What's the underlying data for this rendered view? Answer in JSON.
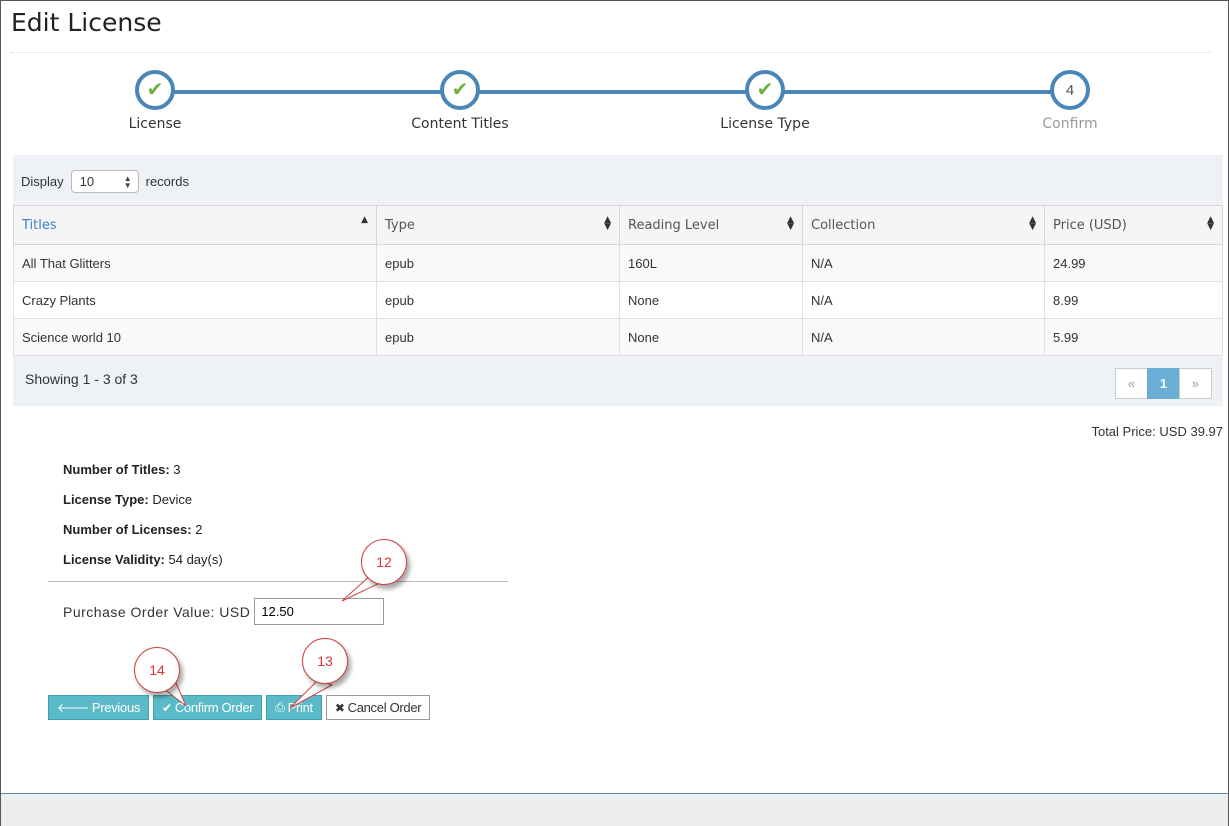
{
  "page": {
    "title": "Edit License"
  },
  "wizard": {
    "steps": [
      {
        "label": "License",
        "state": "done",
        "marker": "✔"
      },
      {
        "label": "Content Titles",
        "state": "done",
        "marker": "✔"
      },
      {
        "label": "License Type",
        "state": "done",
        "marker": "✔"
      },
      {
        "label": "Confirm",
        "state": "pending",
        "marker": "4"
      }
    ]
  },
  "records": {
    "prefix": "Display",
    "value": "10",
    "suffix": "records"
  },
  "table": {
    "columns": [
      "Titles",
      "Type",
      "Reading Level",
      "Collection",
      "Price (USD)"
    ],
    "rows": [
      [
        "All That Glitters",
        "epub",
        "160L",
        "N/A",
        "24.99"
      ],
      [
        "Crazy Plants",
        "epub",
        "None",
        "N/A",
        "8.99"
      ],
      [
        "Science world 10",
        "epub",
        "None",
        "N/A",
        "5.99"
      ]
    ]
  },
  "pagination": {
    "showing": "Showing 1 - 3 of 3",
    "prev": "«",
    "current": "1",
    "next": "»"
  },
  "total": {
    "label": "Total Price:",
    "value": "USD 39.97"
  },
  "summary": {
    "titles_label": "Number of Titles:",
    "titles_value": "3",
    "type_label": "License Type:",
    "type_value": "Device",
    "licenses_label": "Number of Licenses:",
    "licenses_value": "2",
    "validity_label": "License Validity:",
    "validity_value": "54 day(s)"
  },
  "purchase_order": {
    "label": "Purchase Order Value: USD",
    "value": "12.50"
  },
  "actions": {
    "previous": "Previous",
    "confirm": "Confirm Order",
    "print": "Print",
    "cancel": "Cancel Order"
  },
  "callouts": [
    "12",
    "13",
    "14"
  ],
  "icons": {
    "previous": "arrow-left-icon",
    "confirm": "check-icon",
    "print": "printer-icon",
    "cancel": "x-icon"
  },
  "colors": {
    "accent": "#4a86b8",
    "check": "#6db33f",
    "button": "#5bbac7",
    "link": "#3a82c4",
    "callout": "#d33333"
  }
}
